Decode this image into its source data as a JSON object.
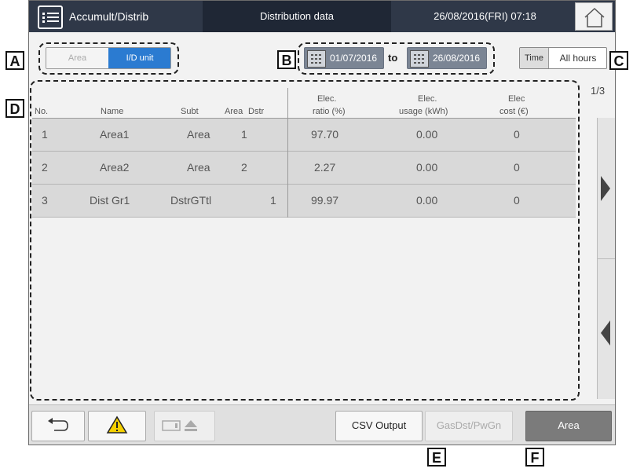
{
  "header": {
    "app_title": "Accumult/Distrib",
    "center_title": "Distribution data",
    "datetime": "26/08/2016(FRI) 07:18"
  },
  "toolbar": {
    "segment_area": "Area",
    "segment_id_unit": "I/D unit",
    "date_from": "01/07/2016",
    "to_label": "to",
    "date_to": "26/08/2016",
    "time_label": "Time",
    "time_value": "All hours"
  },
  "table": {
    "page_indicator": "1/3",
    "headers": {
      "no": "No.",
      "name": "Name",
      "subt": "Subt",
      "area": "Area",
      "dstr": "Dstr",
      "ratio_1": "Elec.",
      "ratio_2": "ratio (%)",
      "usage_1": "Elec.",
      "usage_2": "usage (kWh)",
      "cost_1": "Elec",
      "cost_2": "cost (€)"
    },
    "rows": [
      {
        "no": "1",
        "name": "Area1",
        "subt": "Area",
        "area": "1",
        "dstr": "",
        "ratio": "97.70",
        "usage": "0.00",
        "cost": "0"
      },
      {
        "no": "2",
        "name": "Area2",
        "subt": "Area",
        "area": "2",
        "dstr": "",
        "ratio": "2.27",
        "usage": "0.00",
        "cost": "0"
      },
      {
        "no": "3",
        "name": "Dist Gr1",
        "subt": "DstrGTtl",
        "area": "",
        "dstr": "1",
        "ratio": "99.97",
        "usage": "0.00",
        "cost": "0"
      }
    ]
  },
  "footer": {
    "csv_output": "CSV Output",
    "gasdst": "GasDst/PwGn",
    "area_button": "Area"
  },
  "callouts": {
    "a": "A",
    "b": "B",
    "c": "C",
    "d": "D",
    "e": "E",
    "f": "F"
  },
  "colors": {
    "header_bg": "#2f3848",
    "accent_blue": "#2b7bd1",
    "row_bg": "#d9d9d9",
    "area_button_bg": "#7b7b7b"
  }
}
